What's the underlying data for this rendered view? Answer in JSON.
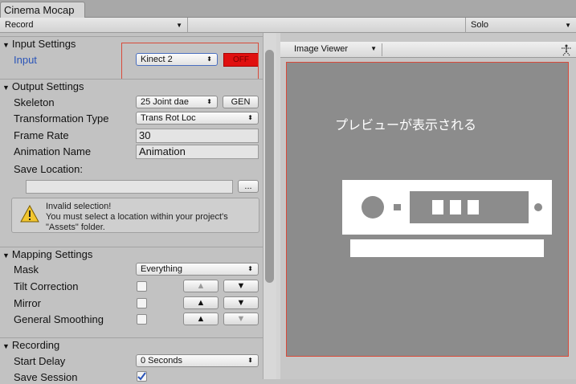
{
  "window": {
    "tab_title": "Cinema Mocap"
  },
  "toolbar": {
    "record": "Record",
    "solo": "Solo"
  },
  "sections": {
    "input": {
      "title": "Input Settings",
      "input_label": "Input",
      "device": "Kinect 2",
      "toggle": "OFF"
    },
    "output": {
      "title": "Output Settings",
      "skeleton_label": "Skeleton",
      "skeleton_value": "25 Joint dae",
      "gen_button": "GEN",
      "transform_label": "Transformation Type",
      "transform_value": "Trans Rot Loc",
      "frame_rate_label": "Frame Rate",
      "frame_rate_value": "30",
      "anim_name_label": "Animation Name",
      "anim_name_value": "Animation",
      "save_loc_label": "Save Location:",
      "browse_button": "...",
      "help_line1": "Invalid selection!",
      "help_line2": "You must select a location within your project's",
      "help_line3": "\"Assets\" folder."
    },
    "mapping": {
      "title": "Mapping Settings",
      "mask_label": "Mask",
      "mask_value": "Everything",
      "tilt_label": "Tilt Correction",
      "mirror_label": "Mirror",
      "smoothing_label": "General Smoothing"
    },
    "recording": {
      "title": "Recording",
      "start_delay_label": "Start Delay",
      "start_delay_value": "0 Seconds",
      "save_session_label": "Save Session"
    }
  },
  "viewer": {
    "dropdown": "Image Viewer",
    "preview_text": "プレビューが表示される"
  },
  "colors": {
    "accent_red": "#e01010",
    "highlight_border": "#d84a3a",
    "label_blue": "#2a54b8"
  }
}
